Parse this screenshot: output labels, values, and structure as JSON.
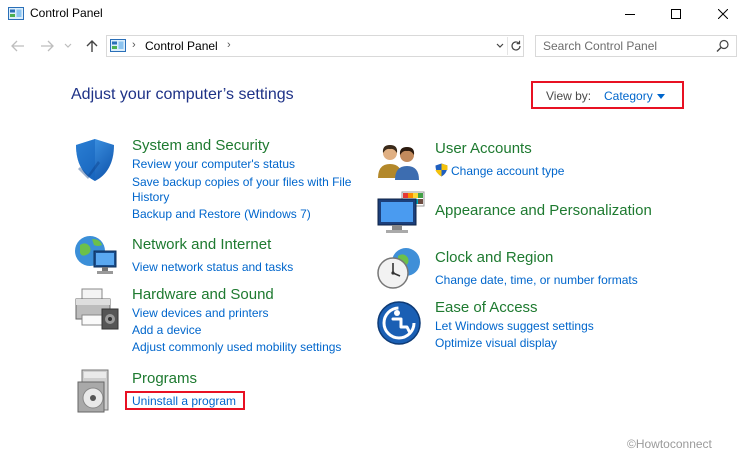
{
  "window": {
    "title": "Control Panel"
  },
  "nav": {
    "crumb": "Control Panel",
    "search_placeholder": "Search Control Panel"
  },
  "main": {
    "heading": "Adjust your computer’s settings",
    "view_by_label": "View by:",
    "view_by_value": "Category"
  },
  "categories": {
    "system": {
      "title": "System and Security",
      "links": [
        "Review your computer's status",
        "Save backup copies of your files with File",
        "History",
        "Backup and Restore (Windows 7)"
      ]
    },
    "network": {
      "title": "Network and Internet",
      "links": [
        "View network status and tasks"
      ]
    },
    "hardware": {
      "title": "Hardware and Sound",
      "links": [
        "View devices and printers",
        "Add a device",
        "Adjust commonly used mobility settings"
      ]
    },
    "programs": {
      "title": "Programs",
      "links": [
        "Uninstall a program"
      ]
    },
    "users": {
      "title": "User Accounts",
      "links": [
        "Change account type"
      ]
    },
    "appearance": {
      "title": "Appearance and Personalization",
      "links": []
    },
    "clock": {
      "title": "Clock and Region",
      "links": [
        "Change date, time, or number formats"
      ]
    },
    "ease": {
      "title": "Ease of Access",
      "links": [
        "Let Windows suggest settings",
        "Optimize visual display"
      ]
    }
  },
  "watermark": "©Howtoconnect",
  "colors": {
    "title_green": "#1e7a30",
    "link_blue": "#0066cc",
    "heading_blue": "#1e3287",
    "highlight_red": "#e81123"
  }
}
